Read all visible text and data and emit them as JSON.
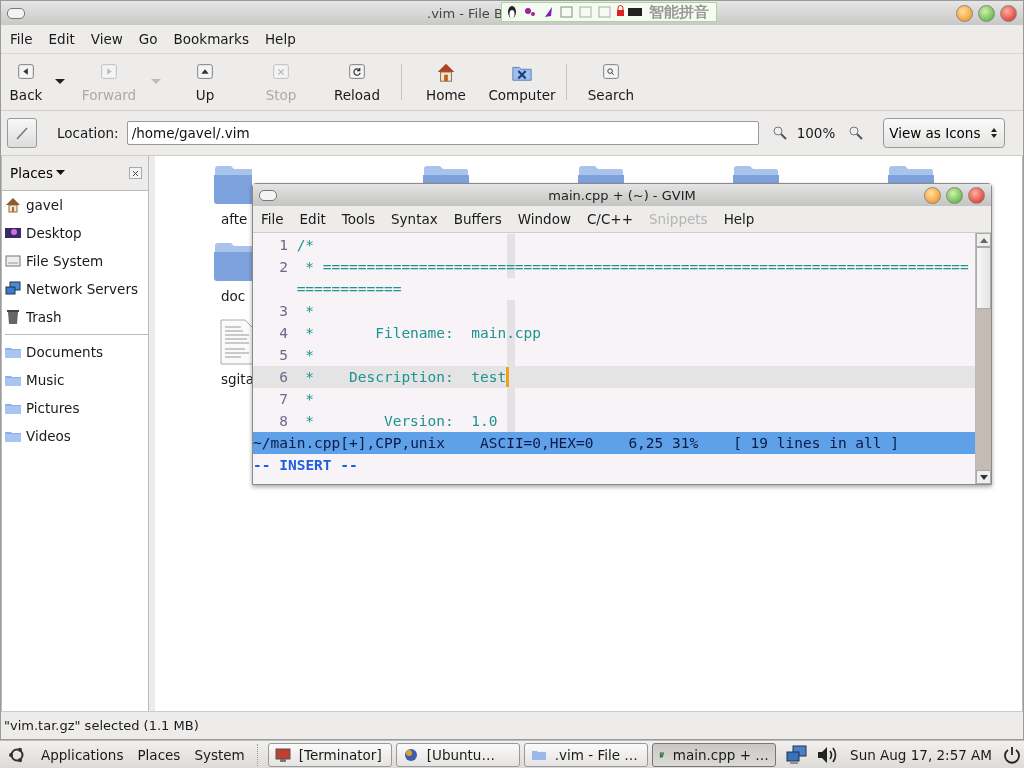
{
  "window": {
    "title": ".vim - File B"
  },
  "input_method_bar": {
    "label": "智能拼音"
  },
  "menu": [
    {
      "label": "File"
    },
    {
      "label": "Edit"
    },
    {
      "label": "View"
    },
    {
      "label": "Go"
    },
    {
      "label": "Bookmarks"
    },
    {
      "label": "Help"
    }
  ],
  "toolbar": [
    {
      "label": "Back",
      "disabled": false,
      "dropdown": true
    },
    {
      "label": "Forward",
      "disabled": true,
      "dropdown": true
    },
    {
      "label": "Up",
      "disabled": false
    },
    {
      "label": "Stop",
      "disabled": true
    },
    {
      "label": "Reload",
      "disabled": false
    },
    {
      "label": "Home",
      "disabled": false
    },
    {
      "label": "Computer",
      "disabled": false
    },
    {
      "label": "Search",
      "disabled": false
    }
  ],
  "location": {
    "label": "Location:",
    "value": "/home/gavel/.vim",
    "zoom": "100%",
    "view": "View as Icons"
  },
  "sidebar": {
    "title": "Places",
    "places": [
      {
        "label": "gavel"
      },
      {
        "label": "Desktop"
      },
      {
        "label": "File System"
      },
      {
        "label": "Network Servers"
      },
      {
        "label": "Trash"
      }
    ],
    "bookmarks": [
      {
        "label": "Documents"
      },
      {
        "label": "Music"
      },
      {
        "label": "Pictures"
      },
      {
        "label": "Videos"
      }
    ]
  },
  "file_rows": [
    [
      {
        "name": "afte",
        "kind": "folder"
      },
      {
        "kind": "folder"
      },
      {
        "kind": "folder"
      },
      {
        "kind": "folder"
      },
      {
        "kind": "folder"
      }
    ],
    [
      {
        "name": "doc",
        "kind": "folder"
      }
    ],
    [
      {
        "name": "sgita",
        "kind": "text"
      }
    ]
  ],
  "status_bar": "\"vim.tar.gz\" selected (1.1 MB)",
  "gvim": {
    "title": "main.cpp + (~) - GVIM",
    "menu": [
      {
        "label": "File",
        "disabled": false
      },
      {
        "label": "Edit",
        "disabled": false
      },
      {
        "label": "Tools",
        "disabled": false
      },
      {
        "label": "Syntax",
        "disabled": false
      },
      {
        "label": "Buffers",
        "disabled": false
      },
      {
        "label": "Window",
        "disabled": false
      },
      {
        "label": "C/C++",
        "disabled": false
      },
      {
        "label": "Snippets",
        "disabled": true
      },
      {
        "label": "Help",
        "disabled": false
      }
    ],
    "lines": [
      {
        "number": "1",
        "text": "/*",
        "current": false
      },
      {
        "number": "2",
        "text": " * ==========================================================================",
        "continuation": "============",
        "current": false
      },
      {
        "number": "3",
        "text": " *",
        "current": false
      },
      {
        "number": "4",
        "text": " *       Filename:  main.cpp",
        "current": false
      },
      {
        "number": "5",
        "text": " *",
        "current": false
      },
      {
        "number": "6",
        "text": " *    Description:  test",
        "current": true
      },
      {
        "number": "7",
        "text": " *",
        "current": false
      },
      {
        "number": "8",
        "text": " *        Version:  1.0",
        "current": false
      }
    ],
    "status_line": "~/main.cpp[+],CPP,unix    ASCII=0,HEX=0    6,25 31%    [ 19 lines in all ]",
    "mode": "-- INSERT --"
  },
  "panel": {
    "menus": [
      {
        "label": "Applications"
      },
      {
        "label": "Places"
      },
      {
        "label": "System"
      }
    ],
    "tasks": [
      {
        "label": "[Terminator]",
        "selected": false
      },
      {
        "label": "[Ubuntu…",
        "selected": false
      },
      {
        "label": ".vim - File …",
        "selected": false
      },
      {
        "label": "main.cpp + …",
        "selected": true
      }
    ],
    "clock": "Sun Aug 17, 2:57 AM"
  }
}
